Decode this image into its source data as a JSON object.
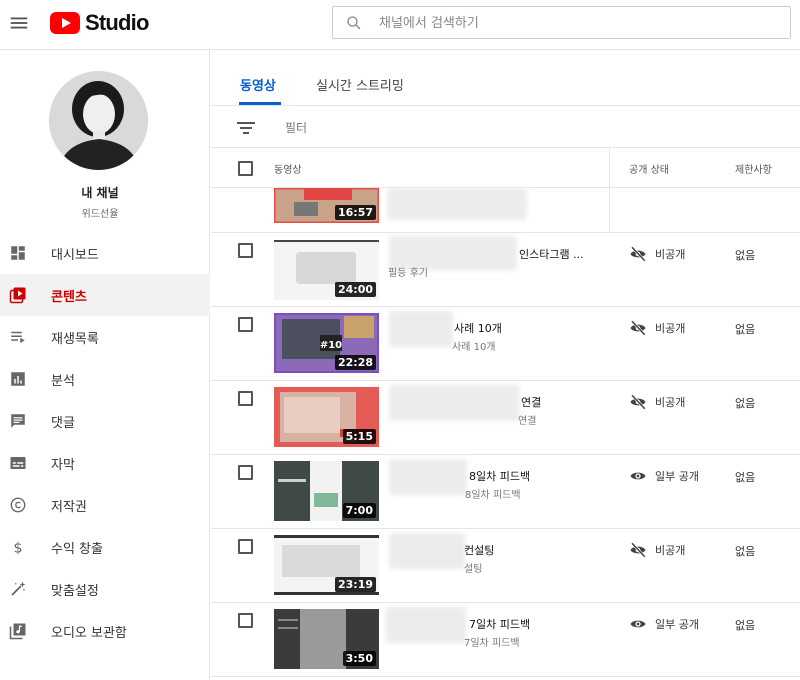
{
  "header": {
    "brand": "Studio",
    "search_placeholder": "채널에서 검색하기"
  },
  "channel": {
    "title": "내 채널",
    "name": "위드선율"
  },
  "sidebar": {
    "items": [
      {
        "label": "대시보드",
        "icon": "dashboard-icon"
      },
      {
        "label": "콘텐츠",
        "icon": "content-icon",
        "active": true
      },
      {
        "label": "재생목록",
        "icon": "playlist-icon"
      },
      {
        "label": "분석",
        "icon": "analytics-icon"
      },
      {
        "label": "댓글",
        "icon": "comments-icon"
      },
      {
        "label": "자막",
        "icon": "subtitles-icon"
      },
      {
        "label": "저작권",
        "icon": "copyright-icon"
      },
      {
        "label": "수익 창출",
        "icon": "monetization-icon"
      },
      {
        "label": "맞춤설정",
        "icon": "customization-icon"
      },
      {
        "label": "오디오 보관함",
        "icon": "audio-library-icon"
      }
    ]
  },
  "tabs": [
    {
      "label": "동영상",
      "active": true
    },
    {
      "label": "실시간 스트리밍"
    }
  ],
  "filter_label": "필터",
  "table": {
    "headers": {
      "video": "동영상",
      "visibility": "공개 상태",
      "restrictions": "제한사항"
    },
    "rows": [
      {
        "duration": "16:57",
        "title": "",
        "desc": "",
        "visibility": "",
        "restrictions": ""
      },
      {
        "duration": "24:00",
        "title": "인스타그램 ...",
        "desc": "필등 후기",
        "visibility": "비공개",
        "vis_icon": "eye-off-icon",
        "restrictions": "없음"
      },
      {
        "duration": "22:28",
        "title": "사례 10개",
        "desc": "사례 10개",
        "visibility": "비공개",
        "vis_icon": "eye-off-icon",
        "restrictions": "없음"
      },
      {
        "duration": "5:15",
        "title": "연결",
        "desc": "연결",
        "visibility": "비공개",
        "vis_icon": "eye-off-icon",
        "restrictions": "없음"
      },
      {
        "duration": "7:00",
        "title": "8일차 피드백",
        "desc": "8일차 피드백",
        "visibility": "일부 공개",
        "vis_icon": "eye-icon",
        "restrictions": "없음"
      },
      {
        "duration": "23:19",
        "title": "컨설팅",
        "desc": "설팅",
        "visibility": "비공개",
        "vis_icon": "eye-off-icon",
        "restrictions": "없음"
      },
      {
        "duration": "3:50",
        "title": "7일차 피드백",
        "desc": "7일차 피드백",
        "visibility": "일부 공개",
        "vis_icon": "eye-icon",
        "restrictions": "없음"
      }
    ]
  },
  "colors": {
    "accent": "#065fd4",
    "active_nav": "#cc0000",
    "brand_red": "#ff0000"
  }
}
